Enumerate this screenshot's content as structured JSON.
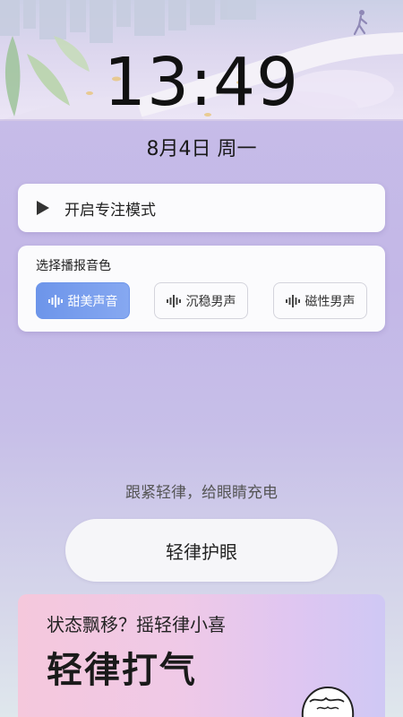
{
  "clock": {
    "time": "13:49",
    "date": "8月4日 周一"
  },
  "focus": {
    "label": "开启专注模式",
    "icon": "play-icon"
  },
  "voice": {
    "title": "选择播报音色",
    "options": [
      {
        "label": "甜美声音",
        "selected": true
      },
      {
        "label": "沉稳男声",
        "selected": false
      },
      {
        "label": "磁性男声",
        "selected": false
      }
    ],
    "icon": "sound-wave-icon"
  },
  "eye_care": {
    "slogan": "跟紧轻律，给眼睛充电",
    "button_label": "轻律护眼"
  },
  "banner": {
    "subtitle": "状态飘移？摇轻律小喜",
    "title": "轻律打气"
  },
  "colors": {
    "accent": "#6d95ea",
    "background": "#c3b7e7",
    "card": "#fbfbfd"
  }
}
